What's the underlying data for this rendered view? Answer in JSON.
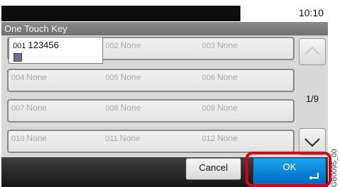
{
  "status_bar": {
    "time": "10:10"
  },
  "header": {
    "title": "One Touch Key"
  },
  "keys": [
    [
      {
        "num": "001",
        "label": "123456"
      },
      {
        "num": "002",
        "label": "None"
      },
      {
        "num": "003",
        "label": "None"
      }
    ],
    [
      {
        "num": "004",
        "label": "None"
      },
      {
        "num": "005",
        "label": "None"
      },
      {
        "num": "006",
        "label": "None"
      }
    ],
    [
      {
        "num": "007",
        "label": "None"
      },
      {
        "num": "008",
        "label": "None"
      },
      {
        "num": "009",
        "label": "None"
      }
    ],
    [
      {
        "num": "010",
        "label": "None"
      },
      {
        "num": "011",
        "label": "None"
      },
      {
        "num": "012",
        "label": "None"
      }
    ]
  ],
  "pager": {
    "page": "1/9"
  },
  "footer": {
    "cancel_label": "Cancel",
    "ok_label": "OK"
  },
  "image_id": "GB0095_00",
  "colors": {
    "ok_blue": "#0a86da",
    "highlight_red": "#d4001a"
  }
}
